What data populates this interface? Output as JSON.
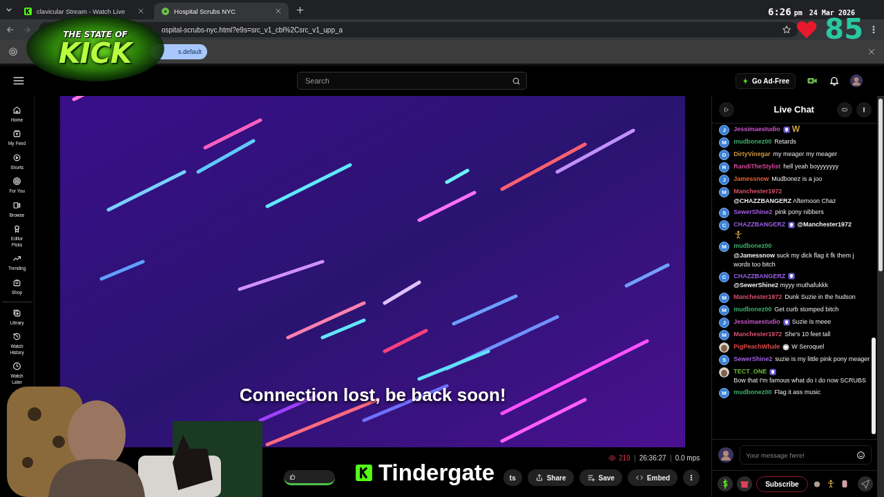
{
  "browser": {
    "tabs": [
      {
        "title": "clavicular Stream - Watch Live",
        "selected": false
      },
      {
        "title": "Hospital Scrubs NYC",
        "selected": true
      }
    ],
    "address": "ospital-scrubs-nyc.html?e9s=src_v1_cbl%2Csrc_v1_upp_a",
    "info_pill": "s.default"
  },
  "overlays": {
    "clock": {
      "time": "6:26",
      "meridiem": "pm",
      "date": "24 Mar 2026"
    },
    "heart_count": "85",
    "logo": {
      "line1": "THE STATE OF",
      "line2": "KICK"
    },
    "caption": "Tindergate"
  },
  "header": {
    "search": {
      "placeholder": "Search"
    },
    "ad_free": "Go Ad-Free"
  },
  "nav": [
    {
      "label": "Home"
    },
    {
      "label": "My Feed"
    },
    {
      "label": "Shorts"
    },
    {
      "label": "For You"
    },
    {
      "label": "Browse"
    },
    {
      "label": "Editor Picks"
    },
    {
      "label": "Trending"
    },
    {
      "label": "Shop"
    },
    {
      "label": "Library",
      "divider": true
    },
    {
      "label": "Watch History"
    },
    {
      "label": "Watch Later"
    }
  ],
  "video": {
    "kind": "picture",
    "message": "Connection lost, be back soon!"
  },
  "stats": {
    "viewers": "219",
    "uptime": "26:36:27",
    "rate": "0.0 mps"
  },
  "actions": [
    {
      "label": "ts"
    },
    {
      "label": "Share"
    },
    {
      "label": "Save"
    },
    {
      "label": "Embed"
    }
  ],
  "chat": {
    "title": "Live Chat",
    "messages": [
      {
        "user": "Jessimaestudio",
        "color": "#c657c9",
        "initial": "J",
        "shield_badge": true,
        "emote": "W"
      },
      {
        "user": "mudbonez00",
        "color": "#3fae6a",
        "initial": "M",
        "text": "Retards"
      },
      {
        "user": "DirtyVinegar",
        "color": "#c9973c",
        "initial": "D",
        "text": "my meager my meager"
      },
      {
        "user": "RandiTheStylist",
        "color": "#d2479a",
        "initial": "R",
        "text": "hell yeah boyyyyyyy"
      },
      {
        "user": "Jamessnow",
        "color": "#e0643c",
        "initial": "J",
        "text": "Mudbonez is a joo"
      },
      {
        "user": "Manchester1972",
        "color": "#d9506a",
        "initial": "M",
        "text": "**@CHAZZBANGERZ** Afternoon Chaz"
      },
      {
        "user": "SewerShine2",
        "color": "#a45ee0",
        "initial": "S",
        "text": "pink pony nibbers"
      },
      {
        "user": "CHAZZBANGERZ",
        "color": "#9a5ee6",
        "initial": "C",
        "shield_badge": true,
        "text": "**@Manchester1972**",
        "sticker": true
      },
      {
        "user": "mudbonez00",
        "color": "#3fae6a",
        "initial": "M",
        "text": "**@Jamessnow** suck my dick flag it fk them j words too bitch"
      },
      {
        "user": "CHAZZBANGERZ",
        "color": "#9a5ee6",
        "initial": "C",
        "shield_badge": true,
        "text": "**@SewerShine2** myyy muthafukkk"
      },
      {
        "user": "Manchester1972",
        "color": "#d9506a",
        "initial": "M",
        "text": "Dunk Suzie in the hudson"
      },
      {
        "user": "mudbonez00",
        "color": "#3fae6a",
        "initial": "M",
        "text": "Get curb stomped bitch"
      },
      {
        "user": "Jessimaestudio",
        "color": "#c657c9",
        "initial": "J",
        "shield_badge": true,
        "text": "Suzie is meee"
      },
      {
        "user": "Manchester1972",
        "color": "#d9506a",
        "initial": "M",
        "text": "She's 10 feet tall"
      },
      {
        "user": "PigPeachWhale",
        "color": "#e04848",
        "bot_badge": true,
        "text": "W Seroquel"
      },
      {
        "user": "SewerShine2",
        "color": "#a45ee0",
        "initial": "S",
        "text": "suzie is my little pink pony meager"
      },
      {
        "user": "TECT_ONE",
        "color": "#6cbf3a",
        "shield_badge": true,
        "text": "Bow that I'm famous what do I do now SCRUBS"
      },
      {
        "user": "mudbonez00",
        "color": "#3fae6a",
        "initial": "M",
        "text": "Flag it ass music"
      }
    ],
    "input": {
      "placeholder": "Your message here!"
    },
    "subscribe": "Subscribe"
  }
}
